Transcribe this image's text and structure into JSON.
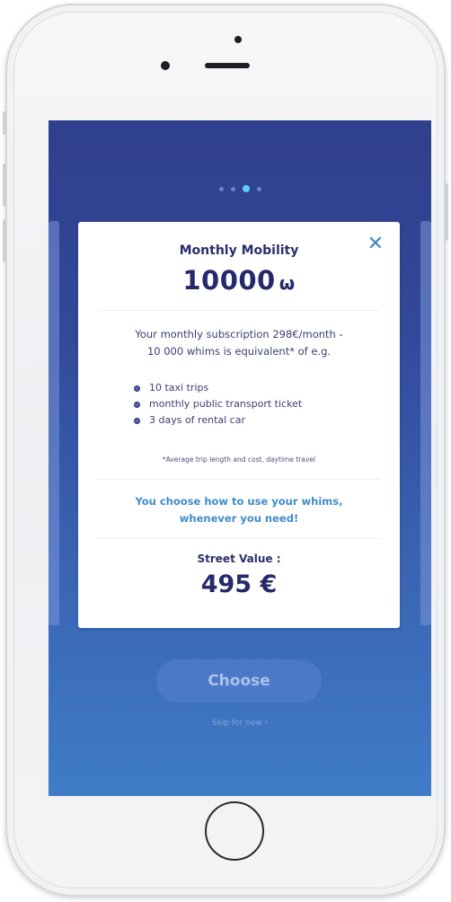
{
  "screen": {
    "pagination": {
      "count": 4,
      "active_index": 2
    }
  },
  "card": {
    "close_icon": "close-icon",
    "close_glyph": "✕",
    "title": "Monthly Mobility",
    "amount": "10000",
    "amount_unit": "ω",
    "description_line1": "Your monthly subscription 298€/month -",
    "description_line2": "10 000 whims is equivalent* of e.g.",
    "bullets": [
      "10 taxi trips",
      "monthly public transport ticket",
      "3 days of rental car"
    ],
    "footnote": "*Average trip length and cost, daytime travel",
    "highlight_line1": "You choose how to use your whims,",
    "highlight_line2": "whenever you need!",
    "street_value_label": "Street Value :",
    "street_value": "495 €"
  },
  "actions": {
    "choose_label": "Choose",
    "skip_label": "Skip for now ›"
  },
  "colors": {
    "screen_top": "#2f3f8c",
    "screen_bottom": "#3f7cc7",
    "accent": "#3f8cc9",
    "text_dark": "#242a6a",
    "pagination_active": "#5ed0ef"
  }
}
